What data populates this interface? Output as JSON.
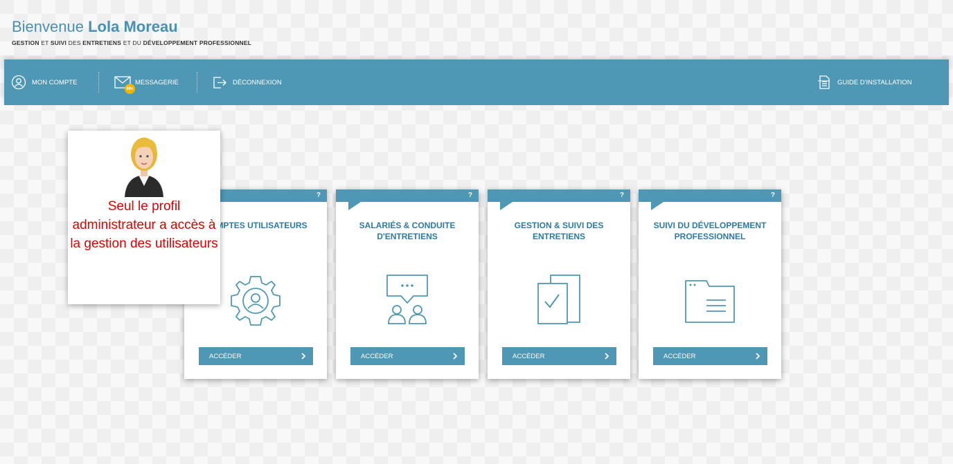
{
  "header": {
    "welcome_prefix": "Bienvenue",
    "user_name": "Lola Moreau",
    "subtitle": {
      "w1": "GESTION",
      "w2": " ET ",
      "w3": "SUIVI",
      "w4": " DES ",
      "w5": "ENTRETIENS",
      "w6": " ET DU ",
      "w7": "DÉVELOPPEMENT PROFESSIONNEL"
    }
  },
  "nav": {
    "account": "MON COMPTE",
    "messaging": "MESSAGERIE",
    "messaging_badge": "99+",
    "logout": "DÉCONNEXION",
    "guide": "GUIDE D'INSTALLATION"
  },
  "cards": [
    {
      "title": "COMPTES UTILISATEURS",
      "button": "ACCÉDER",
      "help": "?",
      "icon": "gear-user-icon"
    },
    {
      "title": "SALARIÉS & CONDUITE D'ENTRETIENS",
      "button": "ACCÉDER",
      "help": "?",
      "icon": "conversation-icon"
    },
    {
      "title": "GESTION & SUIVI DES ENTRETIENS",
      "button": "ACCÉDER",
      "help": "?",
      "icon": "document-check-icon"
    },
    {
      "title": "SUIVI DU DÉVELOPPEMENT PROFESSIONNEL",
      "button": "ACCÉDER",
      "help": "?",
      "icon": "folder-icon"
    }
  ],
  "tooltip": {
    "text": "Seul le profil administrateur a accès à la gestion des utilisateurs"
  },
  "colors": {
    "primary": "#4e98b5",
    "title_blue": "#2d7aa0",
    "badge": "#f0b400",
    "tooltip_text": "#e00000"
  }
}
